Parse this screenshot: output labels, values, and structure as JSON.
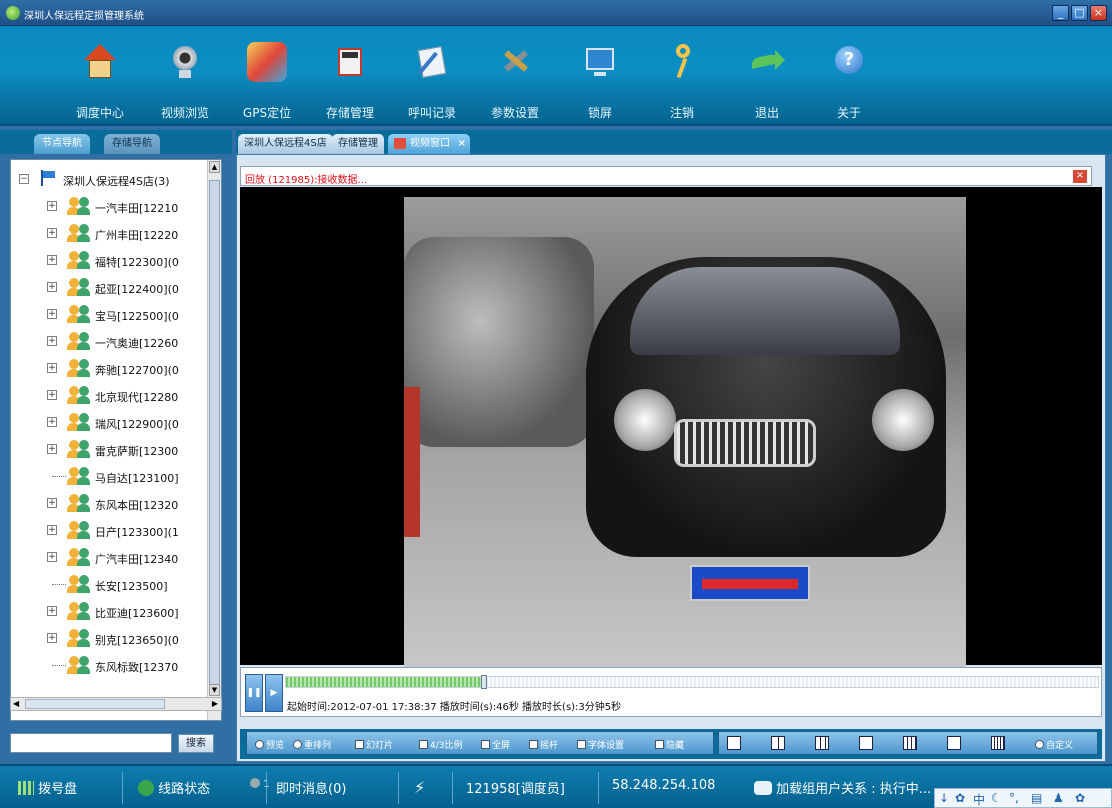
{
  "window": {
    "title": "深圳人保远程定损管理系统"
  },
  "toolbar": {
    "items": [
      {
        "label": "调度中心",
        "icon": "home-icon"
      },
      {
        "label": "视频浏览",
        "icon": "camera-icon"
      },
      {
        "label": "GPS定位",
        "icon": "map-icon"
      },
      {
        "label": "存储管理",
        "icon": "storage-icon"
      },
      {
        "label": "呼叫记录",
        "icon": "call-log-icon"
      },
      {
        "label": "参数设置",
        "icon": "settings-icon"
      },
      {
        "label": "锁屏",
        "icon": "lock-screen-icon"
      },
      {
        "label": "注销",
        "icon": "key-icon"
      },
      {
        "label": "退出",
        "icon": "exit-arrow-icon"
      },
      {
        "label": "关于",
        "icon": "help-icon"
      }
    ]
  },
  "left_tabs": {
    "node_nav": "节点导航",
    "storage_nav": "存储导航"
  },
  "tree": {
    "root": "深圳人保远程4S店(3)",
    "items": [
      {
        "label": "一汽丰田[12210",
        "expandable": true
      },
      {
        "label": "广州丰田[12220",
        "expandable": true
      },
      {
        "label": "福特[122300](0",
        "expandable": true
      },
      {
        "label": "起亚[122400](0",
        "expandable": true
      },
      {
        "label": "宝马[122500](0",
        "expandable": true
      },
      {
        "label": "一汽奥迪[12260",
        "expandable": true
      },
      {
        "label": "奔驰[122700](0",
        "expandable": true
      },
      {
        "label": "北京现代[12280",
        "expandable": true
      },
      {
        "label": "瑞风[122900](0",
        "expandable": true
      },
      {
        "label": "雷克萨斯[12300",
        "expandable": true
      },
      {
        "label": "马自达[123100]",
        "expandable": false
      },
      {
        "label": "东风本田[12320",
        "expandable": true
      },
      {
        "label": "日产[123300](1",
        "expandable": true
      },
      {
        "label": "广汽丰田[12340",
        "expandable": true
      },
      {
        "label": "长安[123500]",
        "expandable": false
      },
      {
        "label": "比亚迪[123600]",
        "expandable": true
      },
      {
        "label": "别克[123650](0",
        "expandable": true
      },
      {
        "label": "东风标致[12370",
        "expandable": false
      }
    ]
  },
  "search": {
    "button": "搜索",
    "value": ""
  },
  "main_tabs": [
    {
      "label": "深圳人保远程4S店"
    },
    {
      "label": "存储管理"
    },
    {
      "label": "视频窗口",
      "close": "×"
    }
  ],
  "video": {
    "status": "回放 (121985):接收数据...",
    "close": "×",
    "info": "起始时间:2012-07-01 17:38:37 播放时间(s):46秒 播放时长(s):3分钟5秒",
    "progress": 0.24
  },
  "options": [
    {
      "label": "预览",
      "type": "radio"
    },
    {
      "label": "重排列",
      "type": "radio"
    },
    {
      "label": "幻灯片",
      "type": "checkbox"
    },
    {
      "label": "4/3比例",
      "type": "checkbox"
    },
    {
      "label": "全屏",
      "type": "checkbox"
    },
    {
      "label": "摇杆",
      "type": "checkbox"
    },
    {
      "label": "字体设置",
      "type": "checkbox"
    },
    {
      "label": "隐藏",
      "type": "checkbox"
    }
  ],
  "layouts": {
    "custom": "自定义"
  },
  "statusbar": {
    "dialpad": "拨号盘",
    "line_status": "线路状态",
    "line_count": "1",
    "instant_msg": "即时消息(0)",
    "user": "121958[调度员]",
    "ip": "58.248.254.108",
    "group_relation": "加载组用户关系 : 执行中..."
  },
  "tray": {
    "ime": "中"
  },
  "colors": {
    "toolbar": "#0c8ec2",
    "status_text": "#e0101a",
    "accent": "#2f6fa4"
  }
}
